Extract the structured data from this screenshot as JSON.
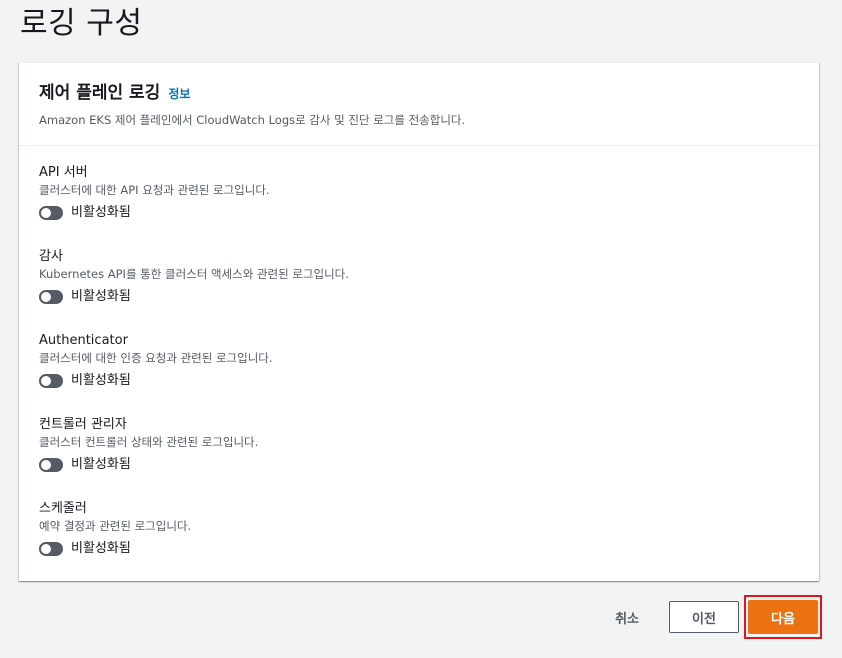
{
  "page": {
    "title": "로깅 구성"
  },
  "panel": {
    "title": "제어 플레인 로깅",
    "info_link": "정보",
    "description": "Amazon EKS 제어 플레인에서 CloudWatch Logs로 감사 및 진단 로그를 전송합니다."
  },
  "log_types": [
    {
      "label": "API 서버",
      "description": "클러스터에 대한 API 요청과 관련된 로그입니다.",
      "status": "비활성화됨"
    },
    {
      "label": "감사",
      "description": "Kubernetes API를 통한 클러스터 액세스와 관련된 로그입니다.",
      "status": "비활성화됨"
    },
    {
      "label": "Authenticator",
      "description": "클러스터에 대한 인증 요청과 관련된 로그입니다.",
      "status": "비활성화됨"
    },
    {
      "label": "컨트롤러 관리자",
      "description": "클러스터 컨트롤러 상태와 관련된 로그입니다.",
      "status": "비활성화됨"
    },
    {
      "label": "스케줄러",
      "description": "예약 결정과 관련된 로그입니다.",
      "status": "비활성화됨"
    }
  ],
  "footer": {
    "cancel_label": "취소",
    "previous_label": "이전",
    "next_label": "다음"
  },
  "colors": {
    "accent": "#ec7211",
    "link": "#0073bb",
    "toggle_off": "#545b64",
    "highlight_box": "#e0151e"
  }
}
